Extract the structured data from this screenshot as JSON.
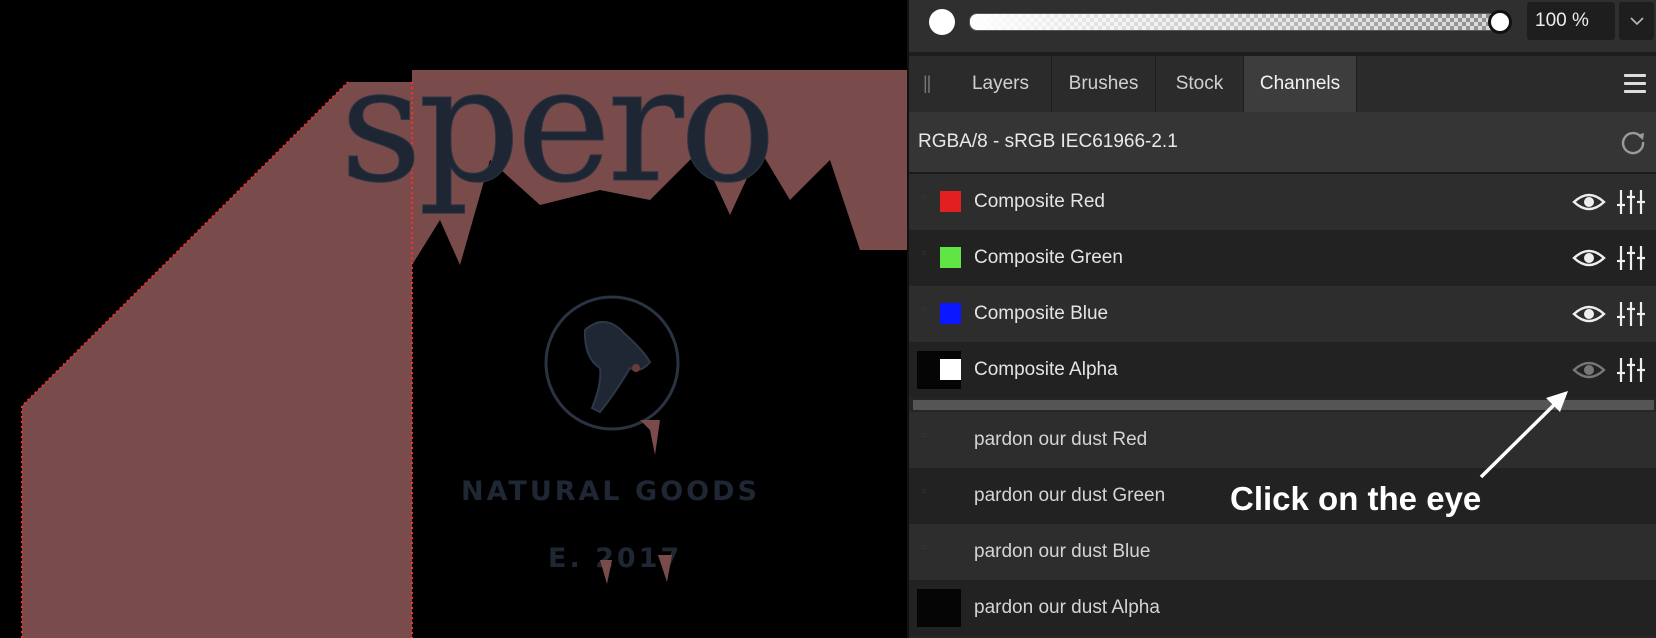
{
  "canvas": {
    "logo_word": "spero",
    "logo_subtitle": "NATURAL GOODS",
    "logo_established": "E. 2017",
    "colors": {
      "shape_fill": "#7a4b4b",
      "outline_red": "#ff2a2a",
      "ink": "#1e2633"
    }
  },
  "toolbar": {
    "opacity_value": "100 %",
    "opacity_fraction": 1.0,
    "dropdown_icon": "chevron-down-icon",
    "brush_color": "#ffffff"
  },
  "tabs": {
    "handle": "||",
    "items": [
      {
        "label": "Layers",
        "active": false
      },
      {
        "label": "Brushes",
        "active": false
      },
      {
        "label": "Stock",
        "active": false
      },
      {
        "label": "Channels",
        "active": true
      }
    ]
  },
  "colorspace": {
    "label": "RGBA/8 - sRGB IEC61966-2.1",
    "refresh_icon": "refresh-icon"
  },
  "composite_channels": [
    {
      "label": "Composite Red",
      "swatch": "#e32020",
      "visible": true
    },
    {
      "label": "Composite Green",
      "swatch": "#5fe645",
      "visible": true
    },
    {
      "label": "Composite Blue",
      "swatch": "#0b18ff",
      "visible": true
    },
    {
      "label": "Composite Alpha",
      "swatch": "#ffffff",
      "visible": false
    }
  ],
  "layer_channels": [
    {
      "label": "pardon our dust Red"
    },
    {
      "label": "pardon our dust Green"
    },
    {
      "label": "pardon our dust Blue"
    },
    {
      "label": "pardon our dust Alpha"
    }
  ],
  "annotation": {
    "text": "Click on the eye"
  }
}
